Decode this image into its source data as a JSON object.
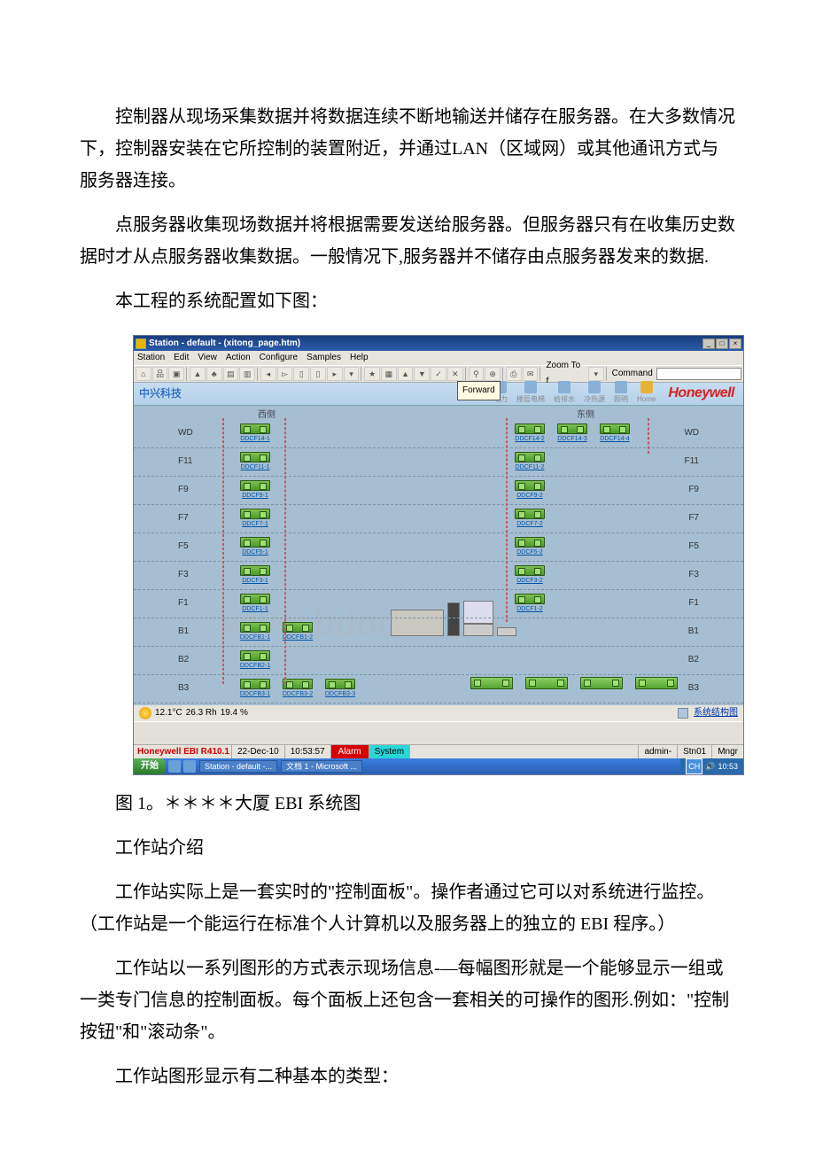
{
  "paragraphs": {
    "p1": "控制器从现场采集数据并将数据连续不断地输送并储存在服务器。在大多数情况下，控制器安装在它所控制的装置附近，并通过LAN（区域网）或其他通讯方式与服务器连接。",
    "p2": "点服务器收集现场数据并将根据需要发送给服务器。但服务器只有在收集历史数据时才从点服务器收集数据。一般情况下,服务器并不储存由点服务器发来的数据.",
    "p3": "本工程的系统配置如下图：",
    "caption": "图 1。＊＊＊＊大厦 EBI 系统图",
    "p4": "工作站介绍",
    "p5": "工作站实际上是一套实时的\"控制面板\"。操作者通过它可以对系统进行监控。（工作站是一个能运行在标准个人计算机以及服务器上的独立的 EBI 程序。）",
    "p6": "工作站以一系列图形的方式表示现场信息-—每幅图形就是一个能够显示一组或一类专门信息的控制面板。每个面板上还包含一套相关的可操作的图形.例如：\"控制按钮\"和\"滚动条\"。",
    "p7": "工作站图形显示有二种基本的类型："
  },
  "window": {
    "title": "Station - default - (xitong_page.htm)",
    "menus": [
      "Station",
      "Edit",
      "View",
      "Action",
      "Configure",
      "Samples",
      "Help"
    ],
    "zoom_label": "Zoom To f",
    "command_label": "Command",
    "tooltip": "Forward",
    "min": "_",
    "max": "□",
    "close": "×"
  },
  "header": {
    "logo_text": "中兴科技",
    "nav_items": [
      "电力",
      "楼层电梯",
      "给排水",
      "冷热源",
      "照明"
    ],
    "home_label": "Home",
    "brand": "Honeywell"
  },
  "diagram": {
    "west_label": "西侧",
    "east_label": "东侧",
    "watermark": "www.bdocx.com",
    "footer_link": "系统结构图",
    "floors": [
      {
        "label": "WD",
        "left": [
          "DDCF14-1"
        ],
        "right": [
          "DDCF14-2",
          "DDCF14-3",
          "DDCF14-4"
        ]
      },
      {
        "label": "F11",
        "left": [
          "DDCF11-1"
        ],
        "right": [
          "DDCF11-2"
        ]
      },
      {
        "label": "F9",
        "left": [
          "DDCF9-1"
        ],
        "right": [
          "DDCF9-2"
        ]
      },
      {
        "label": "F7",
        "left": [
          "DDCF7-1"
        ],
        "right": [
          "DDCF7-2"
        ]
      },
      {
        "label": "F5",
        "left": [
          "DDCF5-1"
        ],
        "right": [
          "DDCF5-2"
        ]
      },
      {
        "label": "F3",
        "left": [
          "DDCF3-1"
        ],
        "right": [
          "DDCF3-2"
        ]
      },
      {
        "label": "F1",
        "left": [
          "DDCF1-1"
        ],
        "right": [
          "DDCF1-2"
        ]
      },
      {
        "label": "B1",
        "left": [
          "DDCFB1-1",
          "DDCFB1-2"
        ],
        "right": []
      },
      {
        "label": "B2",
        "left": [
          "DDCFB2-1"
        ],
        "right": []
      },
      {
        "label": "B3",
        "left": [
          "DDCFB3-1",
          "DDCFB3-2",
          "DDCFB3-3"
        ],
        "right": [],
        "large_right": 4
      }
    ]
  },
  "env": {
    "temp": "12.1°C",
    "hum": "26.3 Rh",
    "pct": "19.4 %"
  },
  "status": {
    "product": "Honeywell EBI R410.1",
    "date": "22-Dec-10",
    "time": "10:53:57",
    "alarm": "Alarm",
    "system": "System",
    "user": "admin-",
    "station": "Stn01",
    "role": "Mngr"
  },
  "taskbar": {
    "start": "开始",
    "tasks": [
      "Station - default -...",
      "文档 1 - Microsoft ..."
    ],
    "clock": "10:53",
    "lang": "CH"
  }
}
